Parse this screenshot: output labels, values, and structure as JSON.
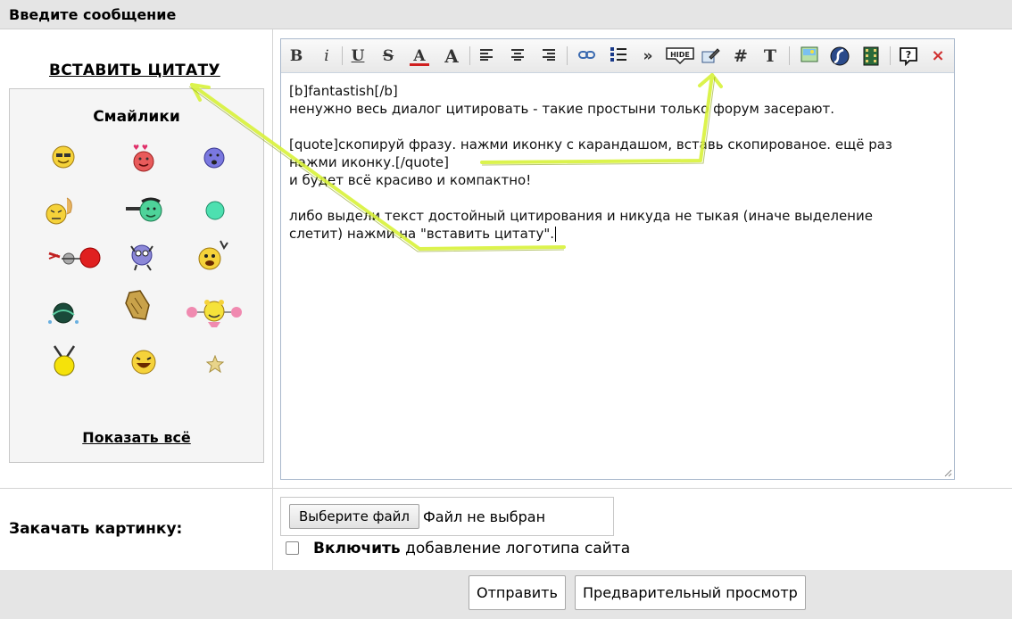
{
  "header": {
    "title": "Введите сообщение"
  },
  "quote_link": "ВСТАВИТЬ ЦИТАТУ",
  "smileys": {
    "title": "Смайлики",
    "show_all": "Показать всё",
    "icons": [
      "cool-smiley-icon",
      "love-smiley-icon",
      "sad-smiley-icon",
      "thinking-smiley-icon",
      "shooting-smiley-icon",
      "round-smiley-icon",
      "fighting-smiley-icon",
      "monster-smiley-icon",
      "waving-smiley-icon",
      "crying-smiley-icon",
      "clapping-hands-icon",
      "cheerleader-smiley-icon",
      "hanging-smiley-icon",
      "laughing-smiley-icon",
      "star-icon"
    ]
  },
  "toolbar": {
    "buttons": [
      "B",
      "i",
      "U",
      "S",
      "A",
      "A",
      "left",
      "center",
      "right",
      "link",
      "list",
      "»",
      "HIDE",
      "quote",
      "#",
      "T",
      "image",
      "flash",
      "video",
      "?",
      "×"
    ]
  },
  "editor": {
    "lines": [
      "[b]fantastish[/b]",
      "ненужно весь диалог цитировать - такие простыни только форум засерают.",
      "",
      "[quote]скопируй фразу. нажми иконку с карандашом, вставь скопированое. ещё раз",
      "нажми иконку.[/quote]",
      "и будет всё красиво и компактно!",
      "",
      "либо выдели текст достойный цитирования и никуда не тыкая (иначе выделение",
      "слетит) нажми на \"вставить цитату\"."
    ]
  },
  "upload": {
    "label": "Закачать картинку:",
    "file_button": "Выберите файл",
    "file_status": "Файл не выбран",
    "checkbox_bold": "Включить",
    "checkbox_rest": " добавление логотипа сайта"
  },
  "footer": {
    "submit": "Отправить",
    "preview": "Предварительный просмотр"
  },
  "colors": {
    "arrow": "#d8f23a",
    "header_bg": "#e5e5e5",
    "editor_border": "#a9b8cc"
  }
}
